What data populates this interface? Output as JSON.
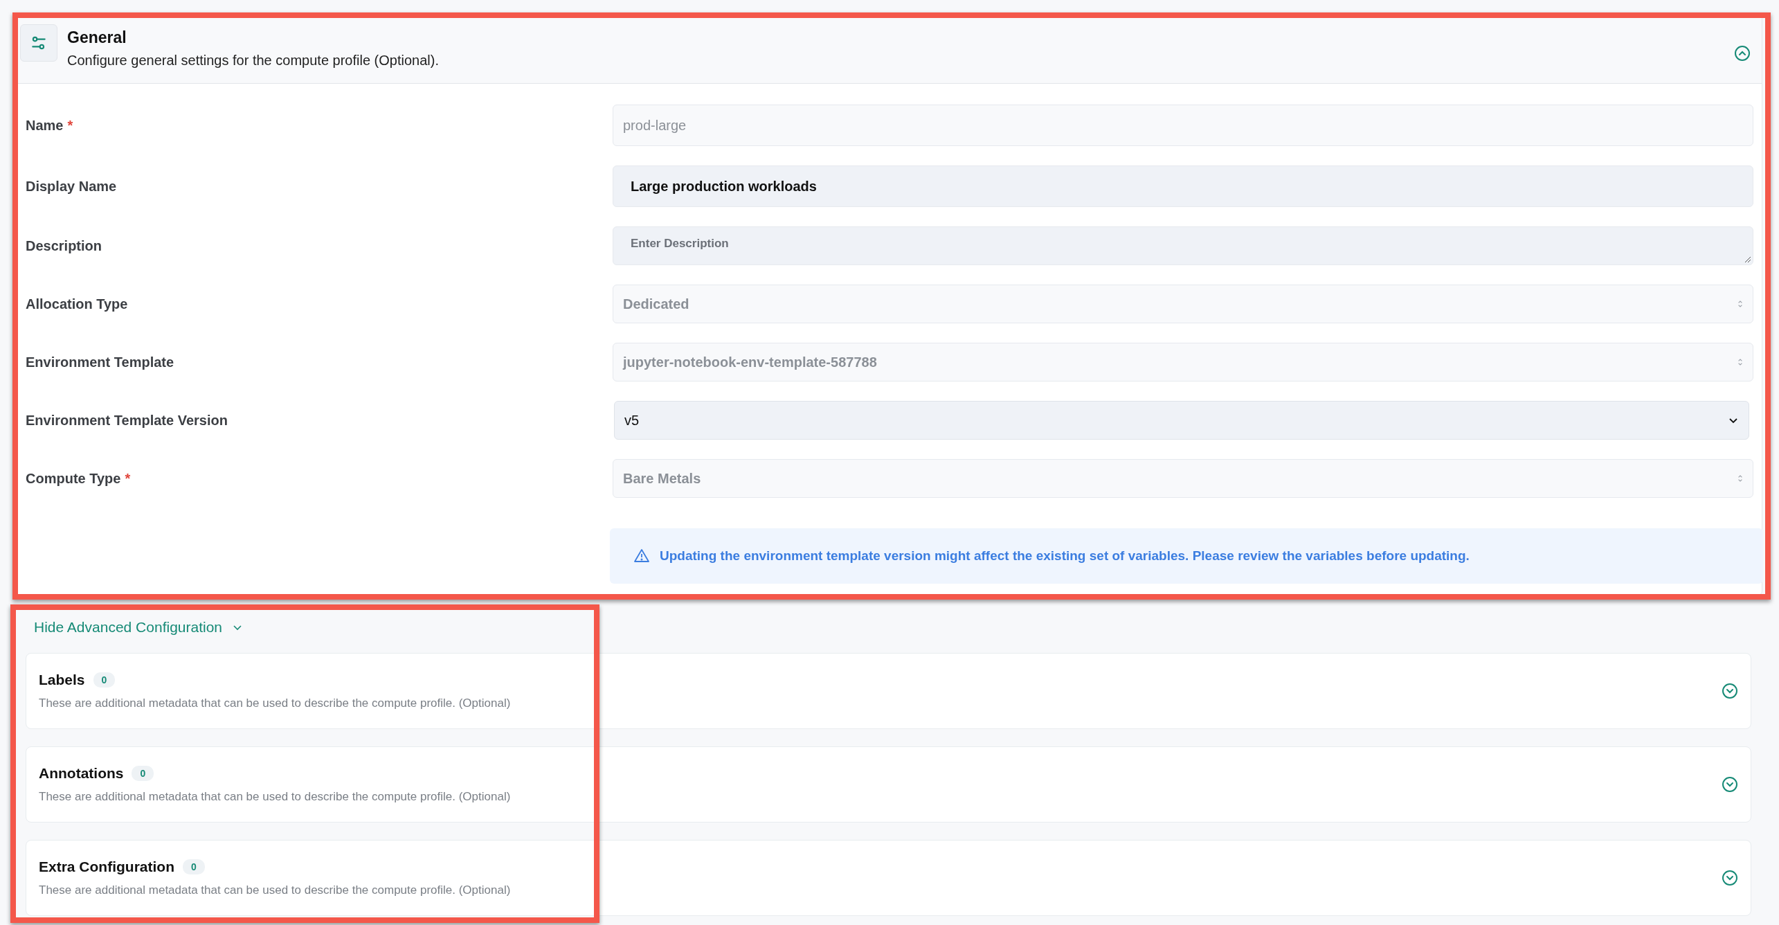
{
  "section": {
    "title": "General",
    "subtitle": "Configure general settings for the compute profile (Optional).",
    "expanded": true
  },
  "fields": [
    {
      "label": "Name",
      "required_mark": "*",
      "kind": "input",
      "disabled": true,
      "value": "prod-large"
    },
    {
      "label": "Display Name",
      "kind": "input",
      "disabled": false,
      "value": "Large production workloads"
    },
    {
      "label": "Description",
      "kind": "textarea",
      "disabled": false,
      "placeholder": "Enter Description"
    },
    {
      "label": "Allocation Type",
      "kind": "select",
      "disabled": true,
      "value": "Dedicated"
    },
    {
      "label": "Environment Template",
      "kind": "select",
      "disabled": true,
      "value": "jupyter-notebook-env-template-587788"
    },
    {
      "label": "Environment Template Version",
      "kind": "select",
      "disabled": false,
      "value": "v5"
    },
    {
      "label": "Compute Type",
      "required_mark": "*",
      "kind": "select",
      "disabled": true,
      "value": "Bare Metals"
    }
  ],
  "alert": {
    "text": "Updating the environment template version might affect the existing set of variables. Please review the variables before updating."
  },
  "advanced_toggle": {
    "label": "Hide Advanced Configuration",
    "expanded": true
  },
  "advanced_sections": [
    {
      "title": "Labels",
      "count": "0",
      "description": "These are additional metadata that can be used to describe the compute profile. (Optional)",
      "expanded": false
    },
    {
      "title": "Annotations",
      "count": "0",
      "description": "These are additional metadata that can be used to describe the compute profile. (Optional)",
      "expanded": false
    },
    {
      "title": "Extra Configuration",
      "count": "0",
      "description": "These are additional metadata that can be used to describe the compute profile. (Optional)",
      "expanded": false
    }
  ]
}
